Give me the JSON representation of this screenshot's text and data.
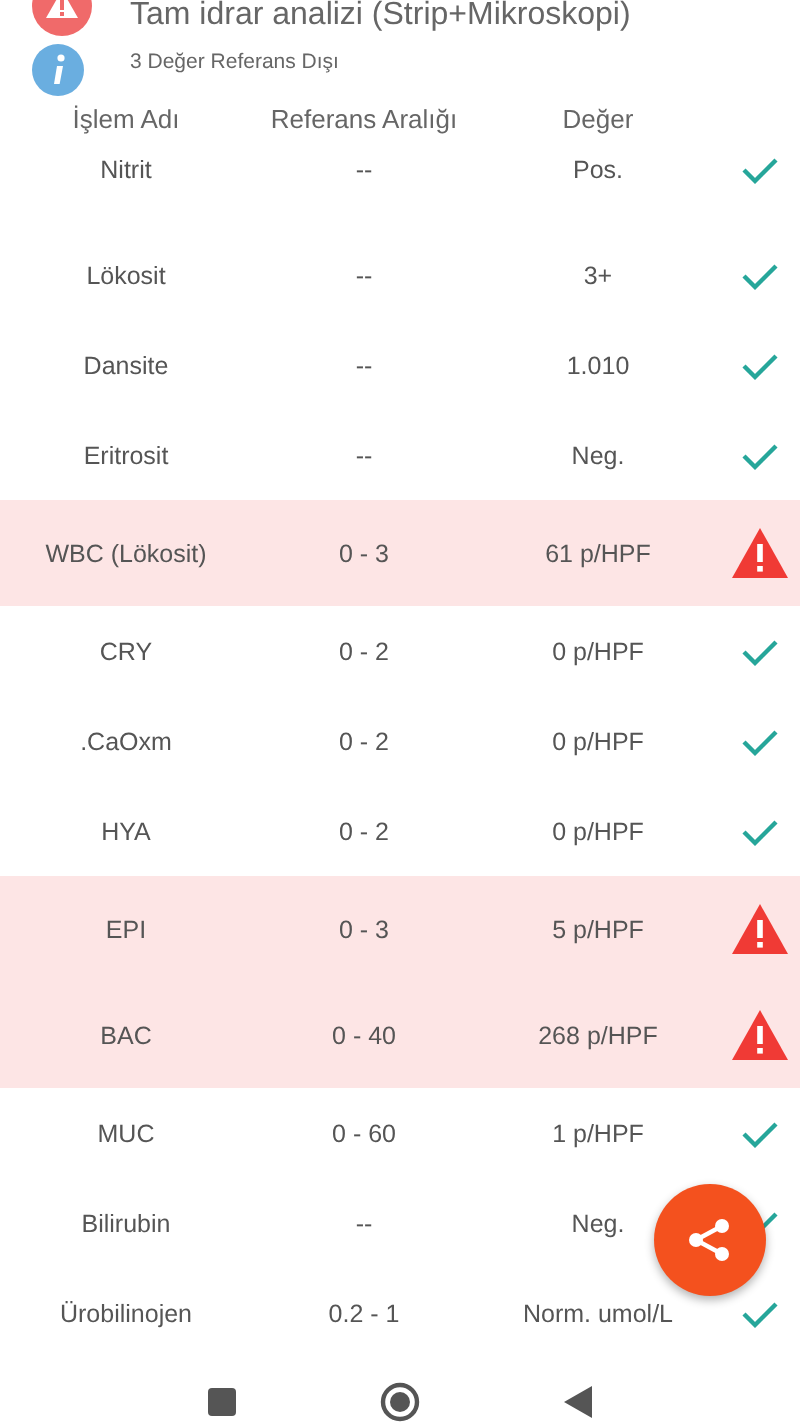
{
  "header": {
    "title": "Tam idrar analizi (Strip+Mikroskopi)",
    "subtitle": "3 Değer Referans Dışı"
  },
  "columns": [
    "İşlem Adı",
    "Referans Aralığı",
    "Değer"
  ],
  "rows": [
    {
      "name": "Nitrit",
      "range": "--",
      "value": "Pos.",
      "out_of_range": false
    },
    {
      "name": "Lökosit",
      "range": "--",
      "value": "3+",
      "out_of_range": false
    },
    {
      "name": "Dansite",
      "range": "--",
      "value": "1.010",
      "out_of_range": false
    },
    {
      "name": "Eritrosit",
      "range": "--",
      "value": "Neg.",
      "out_of_range": false
    },
    {
      "name": "WBC (Lökosit)",
      "range": "0 - 3",
      "value": "61 p/HPF",
      "out_of_range": true
    },
    {
      "name": "CRY",
      "range": "0 - 2",
      "value": "0 p/HPF",
      "out_of_range": false
    },
    {
      "name": ".CaOxm",
      "range": "0 - 2",
      "value": "0 p/HPF",
      "out_of_range": false
    },
    {
      "name": "HYA",
      "range": "0 - 2",
      "value": "0 p/HPF",
      "out_of_range": false
    },
    {
      "name": "EPI",
      "range": "0 - 3",
      "value": "5 p/HPF",
      "out_of_range": true
    },
    {
      "name": "BAC",
      "range": "0 - 40",
      "value": "268 p/HPF",
      "out_of_range": true
    },
    {
      "name": "MUC",
      "range": "0 - 60",
      "value": "1 p/HPF",
      "out_of_range": false
    },
    {
      "name": "Bilirubin",
      "range": "--",
      "value": "Neg.",
      "out_of_range": false
    },
    {
      "name": "Ürobilinojen",
      "range": "0.2 - 1",
      "value": "Norm. umol/L",
      "out_of_range": false
    }
  ]
}
